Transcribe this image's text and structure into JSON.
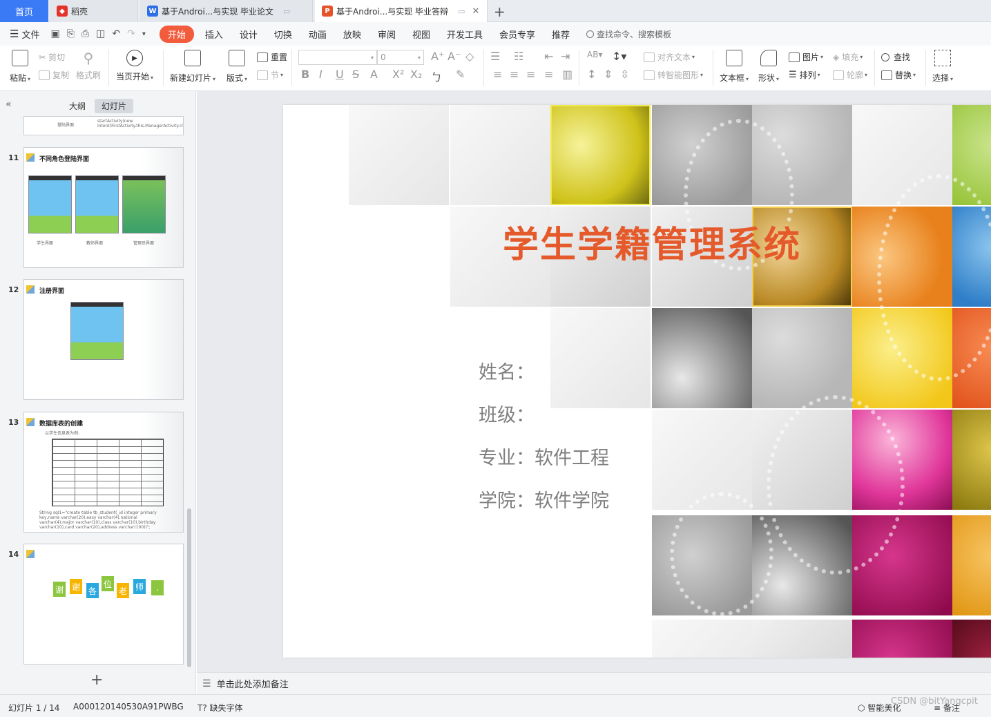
{
  "tabs": {
    "home": "首页",
    "wps": "稻壳",
    "doc1": "基于Androi...与实现 毕业论文",
    "doc2": "基于Androi...与实现 毕业答辩"
  },
  "menu": {
    "file": "文件",
    "tabs": [
      "开始",
      "插入",
      "设计",
      "切换",
      "动画",
      "放映",
      "审阅",
      "视图",
      "开发工具",
      "会员专享",
      "推荐"
    ],
    "search": "查找命令、搜索模板"
  },
  "ribbon": {
    "paste": "粘贴",
    "cut": "剪切",
    "copy": "复制",
    "format_painter": "格式刷",
    "play_current": "当页开始",
    "new_slide": "新建幻灯片",
    "layout": "版式",
    "reset": "重置",
    "section": "节",
    "font_size": "0",
    "align_text": "对齐文本",
    "smart_shape": "转智能图形",
    "text_box": "文本框",
    "shape": "形状",
    "picture": "图片",
    "arrange": "排列",
    "fill": "填充",
    "outline": "轮廓",
    "find": "查找",
    "replace": "替换",
    "select": "选择"
  },
  "left_panel": {
    "tab_outline": "大纲",
    "tab_slides": "幻灯片",
    "slides": [
      {
        "num": "11",
        "title": "不同角色登陆界面",
        "captions": [
          "学生界面",
          "教师界面",
          "管理员界面"
        ]
      },
      {
        "num": "12",
        "title": "注册界面"
      },
      {
        "num": "13",
        "title": "数据库表的创建",
        "subtitle": "以学生信息表为例:",
        "code": "String sql1=\"create table tb_student(_id integer primary key,name varchar(20),easy varchar(4),national varchar(4),major varchar(10),class varchar(10),birthday varchar(10),card varchar(20),address varchar(100))\";"
      },
      {
        "num": "14",
        "title": "",
        "thanks": [
          "谢",
          "谢",
          "各",
          "位",
          "老",
          "师",
          "."
        ]
      }
    ],
    "prev_snippet": "startActivity(new Intent(FirstActivity.this,ManagerActivity.class));",
    "prev_caption": "登陆界面"
  },
  "slide": {
    "title": "学生学籍管理系统",
    "lines": [
      "姓名：",
      "班级：",
      "专业：软件工程",
      "学院：软件学院"
    ]
  },
  "notes": {
    "placeholder": "单击此处添加备注"
  },
  "status": {
    "slide_counter": "幻灯片 1 / 14",
    "template_id": "A000120140530A91PWBG",
    "missing_font": "缺失字体",
    "smart_beautify": "智能美化",
    "notes_btn": "备注",
    "watermark": "CSDN @bitYangcpit"
  },
  "colors": {
    "accent": "#3a7af5",
    "active_menu": "#f25b3c",
    "title_orange": "#e55a2b"
  }
}
